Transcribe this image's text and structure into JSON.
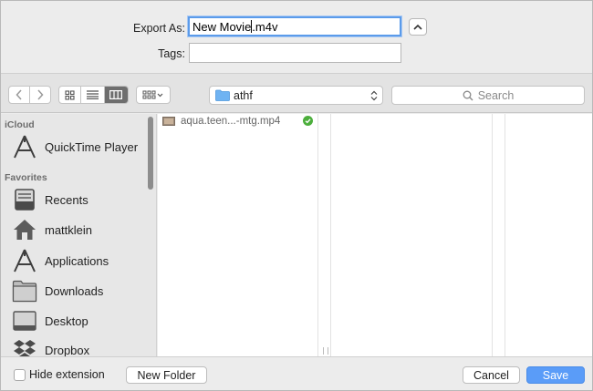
{
  "export": {
    "label": "Export As:",
    "filename_base": "New Movie",
    "filename_ext": ".m4v",
    "tags_label": "Tags:",
    "tags_value": ""
  },
  "toolbar": {
    "path": "athf",
    "search_placeholder": "Search"
  },
  "sidebar": {
    "sections": [
      {
        "title": "iCloud",
        "items": [
          {
            "label": "QuickTime Player",
            "icon": "quicktime-icon"
          }
        ]
      },
      {
        "title": "Favorites",
        "items": [
          {
            "label": "Recents",
            "icon": "recents-icon"
          },
          {
            "label": "mattklein",
            "icon": "home-icon"
          },
          {
            "label": "Applications",
            "icon": "applications-icon"
          },
          {
            "label": "Downloads",
            "icon": "downloads-icon"
          },
          {
            "label": "Desktop",
            "icon": "desktop-icon"
          },
          {
            "label": "Dropbox",
            "icon": "dropbox-icon"
          }
        ]
      }
    ]
  },
  "files": [
    {
      "name": "aqua.teen...-mtg.mp4",
      "status": "synced"
    }
  ],
  "bottom": {
    "hide_extension": "Hide extension",
    "new_folder": "New Folder",
    "cancel": "Cancel",
    "save": "Save"
  },
  "colors": {
    "accent": "#5a9cf8",
    "focus_ring": "#5b9bea",
    "synced": "#4cae3c"
  }
}
